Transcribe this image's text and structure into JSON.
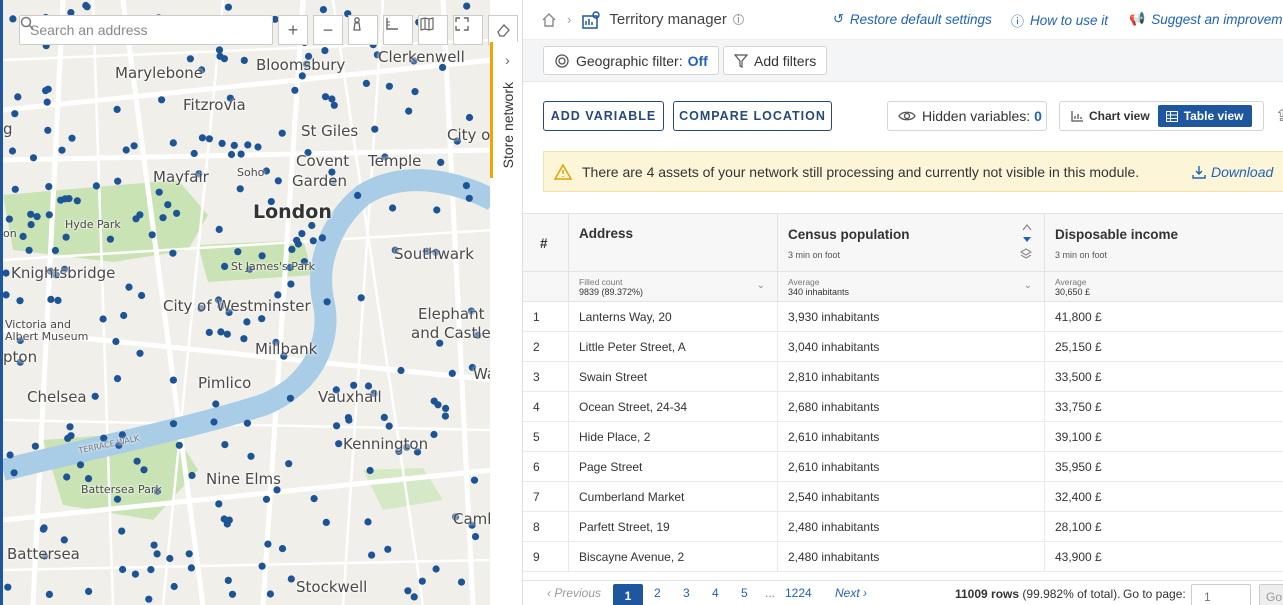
{
  "map": {
    "search_placeholder": "Search an address",
    "store_tab_label": "Store network",
    "labels": {
      "marylebone": "Marylebone",
      "bloomsbury": "Bloomsbury",
      "clerkenwell": "Clerkenwell",
      "fitzrovia": "Fitzrovia",
      "st_giles": "St Giles",
      "city_of": "City of",
      "mayfair": "Mayfair",
      "soho": "Soho",
      "covent_garden_1": "Covent",
      "covent_garden_2": "Garden",
      "temple": "Temple",
      "london": "London",
      "hyde_park": "Hyde Park",
      "southwark": "Southwark",
      "st_james_park": "St James's Park",
      "knightsbridge": "Knightsbridge",
      "city_of_westminster": "City of Westminster",
      "elephant_1": "Elephant",
      "elephant_2": "and Castle",
      "victoria_1": "Victoria and",
      "victoria_2": "Albert Museum",
      "millbank": "Millbank",
      "walworth": "Walwo",
      "pimlico": "Pimlico",
      "chelsea": "Chelsea",
      "vauxhall": "Vauxhall",
      "terrace_walk": "TERRACE WALK",
      "kennington": "Kennington",
      "nine_elms": "Nine Elms",
      "battersea_park": "Battersea Park",
      "camb": "Camb",
      "battersea": "Battersea",
      "stockwell": "Stockwell",
      "on": "on",
      "pton": "pton",
      "g": "g",
      "on2": "on"
    }
  },
  "topbar": {
    "title": "Territory manager",
    "restore": "Restore default settings",
    "how_to": "How to use it",
    "suggest": "Suggest an improvement"
  },
  "filters": {
    "geo_label": "Geographic filter:",
    "geo_value": "Off",
    "add_filters": "Add filters"
  },
  "actions": {
    "add_variable": "ADD VARIABLE",
    "compare_location": "COMPARE LOCATION",
    "hidden_label": "Hidden variables:",
    "hidden_count": "0",
    "chart_view": "Chart view",
    "table_view": "Table view"
  },
  "alert": {
    "text": "There are 4 assets of your network still processing and currently not visible in this module.",
    "download": "Download"
  },
  "table": {
    "headers": {
      "num": "#",
      "address": "Address",
      "census": "Census population",
      "census_sub": "3 min on foot",
      "income": "Disposable income",
      "income_sub": "3 min on foot"
    },
    "summary": {
      "address_l1": "Filled count",
      "address_l2": "9839 (89.372%)",
      "census_l1": "Average",
      "census_l2": "340 inhabitants",
      "income_l1": "Average",
      "income_l2": "30,650 £"
    },
    "rows": [
      {
        "n": "1",
        "address": "Lanterns Way, 20",
        "census": "3,930 inhabitants",
        "income": "41,800 £"
      },
      {
        "n": "2",
        "address": "Little Peter Street, A",
        "census": "3,040 inhabitants",
        "income": "25,150 £"
      },
      {
        "n": "3",
        "address": "Swain Street",
        "census": "2,810 inhabitants",
        "income": "33,500 £"
      },
      {
        "n": "4",
        "address": "Ocean Street, 24-34",
        "census": "2,680 inhabitants",
        "income": "33,750 £"
      },
      {
        "n": "5",
        "address": "Hide Place, 2",
        "census": "2,610 inhabitants",
        "income": "39,100 £"
      },
      {
        "n": "6",
        "address": "Page Street",
        "census": "2,610 inhabitants",
        "income": "35,950 £"
      },
      {
        "n": "7",
        "address": "Cumberland Market",
        "census": "2,540 inhabitants",
        "income": "32,400 £"
      },
      {
        "n": "8",
        "address": "Parfett Street, 19",
        "census": "2,480 inhabitants",
        "income": "28,100 £"
      },
      {
        "n": "9",
        "address": "Biscayne Avenue, 2",
        "census": "2,480 inhabitants",
        "income": "43,900 £"
      }
    ]
  },
  "pager": {
    "previous": "Previous",
    "pages": [
      "1",
      "2",
      "3",
      "4",
      "5"
    ],
    "ellipsis": "...",
    "last": "1224",
    "next": "Next",
    "rows_bold": "11009 rows",
    "rows_rest": "(99.982% of total).",
    "goto_label": "Go to page:",
    "goto_placeholder": "1",
    "go": "Go"
  }
}
